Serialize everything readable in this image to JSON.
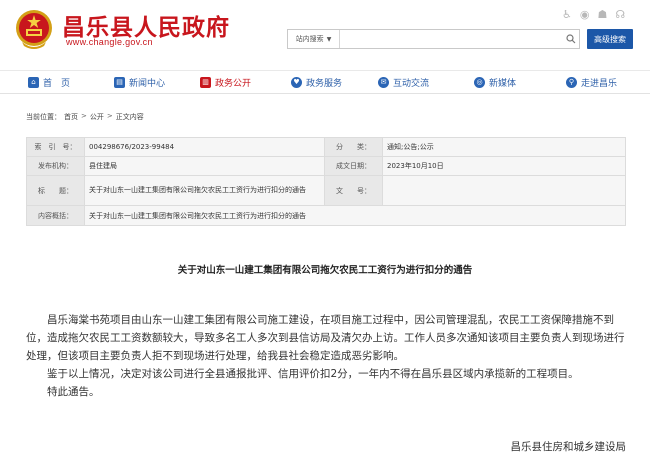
{
  "header": {
    "title": "昌乐县人民政府",
    "domain": "www.changle.gov.cn",
    "accessibility_icons": [
      "wheelchair-icon",
      "eye-icon",
      "elder-icon",
      "ear-icon"
    ],
    "search": {
      "scope_label": "站内搜索",
      "placeholder": "",
      "value": ""
    },
    "advanced_search_label": "高级搜索"
  },
  "nav": [
    {
      "icon": "home-icon",
      "label": "首　页",
      "color": "#2b65b5"
    },
    {
      "icon": "news-icon",
      "label": "新闻中心",
      "color": "#2b65b5"
    },
    {
      "icon": "building-icon",
      "label": "政务公开",
      "color": "#c8161d",
      "active": true
    },
    {
      "icon": "heart-icon",
      "label": "政务服务",
      "color": "#2b65b5"
    },
    {
      "icon": "chat-icon",
      "label": "互动交流",
      "color": "#2b65b5"
    },
    {
      "icon": "media-icon",
      "label": "新媒体",
      "color": "#2b65b5"
    },
    {
      "icon": "location-icon",
      "label": "走进昌乐",
      "color": "#2b65b5"
    }
  ],
  "breadcrumb": {
    "label": "当前位置：",
    "items": [
      "首页",
      "公开",
      "正文内容"
    ],
    "separator": ">"
  },
  "info": {
    "index_key": "索　引　号：",
    "index_value": "004298676/2023-99484",
    "category_key": "分　　类：",
    "category_value": "通知;公告;公示",
    "publisher_key": "发布机构：",
    "publisher_value": "县住建局",
    "date_key": "成文日期：",
    "date_value": "2023年10月10日",
    "title_key": "标　　题：",
    "title_value": "关于对山东一山建工集团有限公司拖欠农民工工资行为进行扣分的通告",
    "docno_key": "文　　号：",
    "docno_value": "",
    "content_key": "内容概括：",
    "content_value": "关于对山东一山建工集团有限公司拖欠农民工工资行为进行扣分的通告"
  },
  "article": {
    "title": "关于对山东一山建工集团有限公司拖欠农民工工资行为进行扣分的通告",
    "paragraphs": [
      "昌乐海棠书苑项目由山东一山建工集团有限公司施工建设，在项目施工过程中，因公司管理混乱，农民工工资保障措施不到位，造成拖欠农民工工资数额较大，导致多名工人多次到县信访局及清欠办上访。工作人员多次通知该项目主要负责人到现场进行处理，但该项目主要负责人拒不到现场进行处理，给我县社会稳定造成恶劣影响。",
      "鉴于以上情况，决定对该公司进行全县通报批评、信用评价扣2分，一年内不得在昌乐县区域内承揽新的工程项目。",
      "特此通告。"
    ],
    "signature": "昌乐县住房和城乡建设局"
  },
  "colors": {
    "brand_red": "#c8161d",
    "brand_blue": "#1c57a8"
  }
}
